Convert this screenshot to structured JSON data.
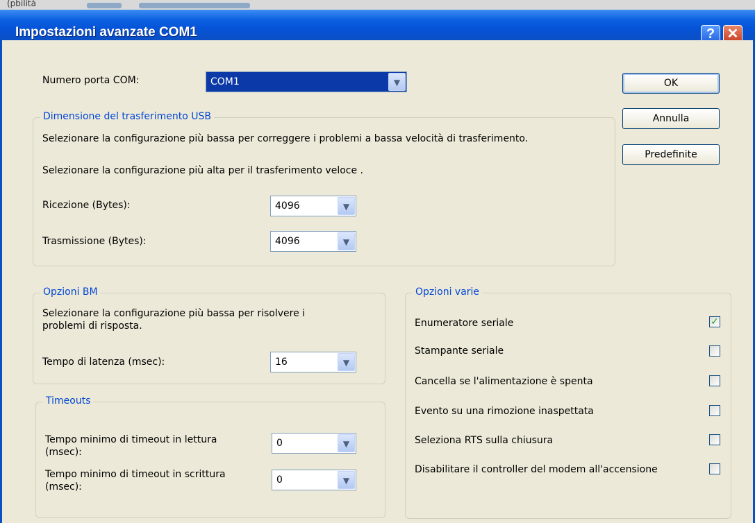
{
  "window": {
    "title": "Impostazioni avanzate COM1",
    "help_glyph": "?",
    "close_glyph": "✕",
    "background_text": "(pbilità"
  },
  "com_port": {
    "label": "Numero porta COM:",
    "value": "COM1"
  },
  "buttons": {
    "ok": "OK",
    "cancel": "Annulla",
    "defaults": "Predefinite"
  },
  "usb_group": {
    "title": "Dimensione del trasferimento USB",
    "hint_low": "Selezionare la configurazione più bassa per correggere i problemi a bassa velocità di trasferimento.",
    "hint_high": "Selezionare la configurazione più alta per il trasferimento veloce .",
    "receive_label": "Ricezione (Bytes):",
    "receive_value": "4096",
    "transmit_label": "Trasmissione (Bytes):",
    "transmit_value": "4096"
  },
  "bm_group": {
    "title": "Opzioni BM",
    "hint_line1": "Selezionare la configurazione più bassa per risolvere i",
    "hint_line2": "problemi di risposta.",
    "latency_label": "Tempo di latenza (msec):",
    "latency_value": "16"
  },
  "timeouts_group": {
    "title": "Timeouts",
    "read_label_line1": "Tempo minimo di timeout in lettura",
    "read_label_line2": "(msec):",
    "read_value": "0",
    "write_label_line1": "Tempo minimo di timeout in scrittura",
    "write_label_line2": "(msec):",
    "write_value": "0"
  },
  "misc_group": {
    "title": "Opzioni varie",
    "options": [
      {
        "label": "Enumeratore seriale",
        "checked": true
      },
      {
        "label": "Stampante seriale",
        "checked": false
      },
      {
        "label": "Cancella se l'alimentazione è spenta",
        "checked": false
      },
      {
        "label": "Evento su una rimozione inaspettata",
        "checked": false
      },
      {
        "label": "Seleziona RTS sulla chiusura",
        "checked": false
      },
      {
        "label": "Disabilitare il controller del modem all'accensione",
        "checked": false
      }
    ]
  },
  "icons": {
    "dropdown": "chevron-down-icon",
    "check": "✓"
  }
}
